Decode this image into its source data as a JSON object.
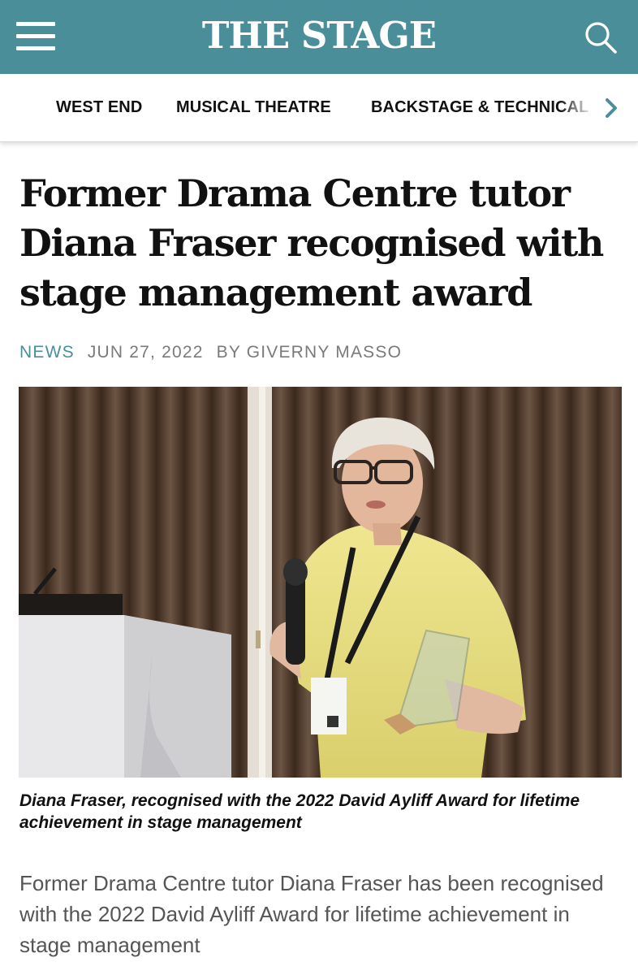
{
  "header": {
    "logo": "THE STAGE",
    "menu_icon": "hamburger-menu-icon",
    "search_icon": "search-icon",
    "background_color": "#4a8e9a"
  },
  "nav": {
    "items": [
      "WEST END",
      "MUSICAL THEATRE",
      "BACKSTAGE & TECHNICAL"
    ],
    "next_icon": "chevron-right-icon"
  },
  "article": {
    "headline": "Former Drama Centre tutor Diana Fraser recognised with stage management award",
    "category": "NEWS",
    "date": "JUN 27, 2022",
    "byline": "BY GIVERNY MASSO",
    "caption": "Diana Fraser, recognised with the 2022 David Ayliff Award for lifetime achievement in stage management",
    "lede": "Former Drama Centre tutor Diana Fraser has been recognised with the 2022 David Ayliff Award for lifetime achievement in stage management"
  },
  "colors": {
    "accent": "#4a8e9a",
    "meta_text": "#7a7a7a"
  }
}
